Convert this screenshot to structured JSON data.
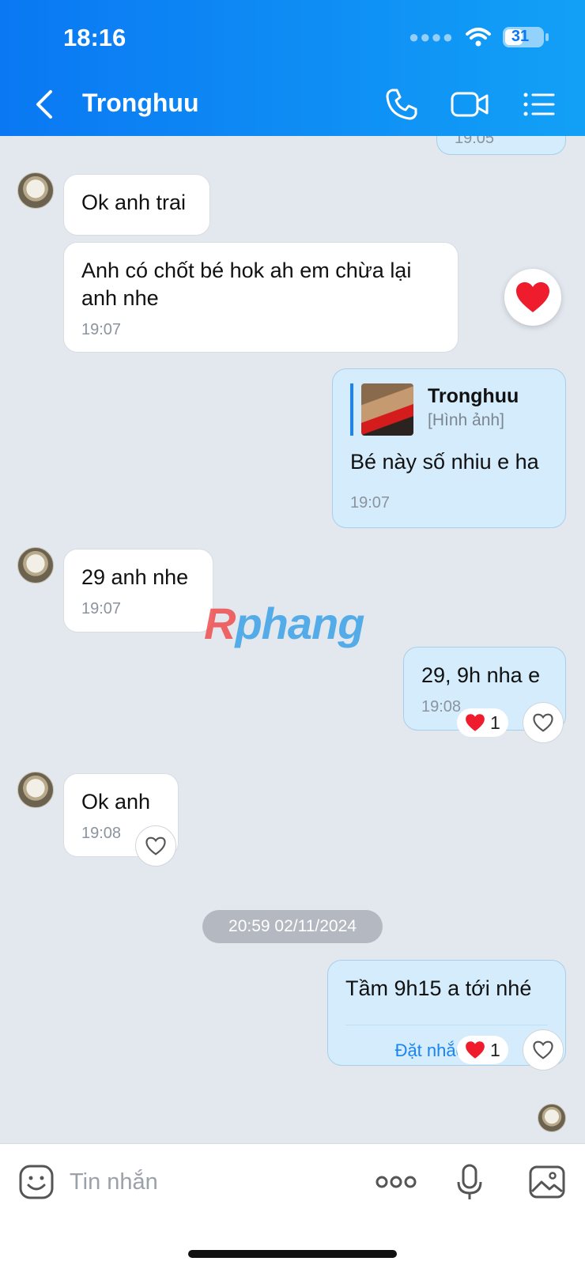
{
  "status_bar": {
    "time": "18:16",
    "battery": "31"
  },
  "header": {
    "title": "Tronghuu"
  },
  "messages": [
    {
      "text": "Ok anh trai"
    },
    {
      "text": "Anh có chốt bé hok ah em chừa lại anh nhe",
      "time": "19:07"
    },
    {
      "quote_name": "Tronghuu",
      "quote_sub": "[Hình ảnh]",
      "text": "Bé này số nhiu e ha",
      "time": "19:07"
    },
    {
      "text": "29 anh nhe",
      "time": "19:07"
    },
    {
      "text": "29, 9h nha e",
      "time": "19:08",
      "reaction_count": "1"
    },
    {
      "text": "Ok anh",
      "time": "19:08"
    },
    {
      "text": "Tầm 9h15 a tới nhé",
      "action": "Đặt nhắc hẹn",
      "reaction_count": "1"
    }
  ],
  "date_divider": "20:59 02/11/2024",
  "partial_top_time": "19:05",
  "watermark": {
    "first": "R",
    "rest": "phang"
  },
  "composer": {
    "placeholder": "Tin nhắn"
  },
  "colors": {
    "header_start": "#0a78f3",
    "header_end": "#12a0f6",
    "sent_bubble": "#d4ecfb",
    "accent": "#1a84f0"
  },
  "icons": [
    "back-arrow-icon",
    "phone-icon",
    "video-call-icon",
    "menu-list-icon",
    "heart-icon",
    "like-heart-outline-icon",
    "sticker-icon",
    "more-icon",
    "microphone-icon",
    "image-icon"
  ]
}
